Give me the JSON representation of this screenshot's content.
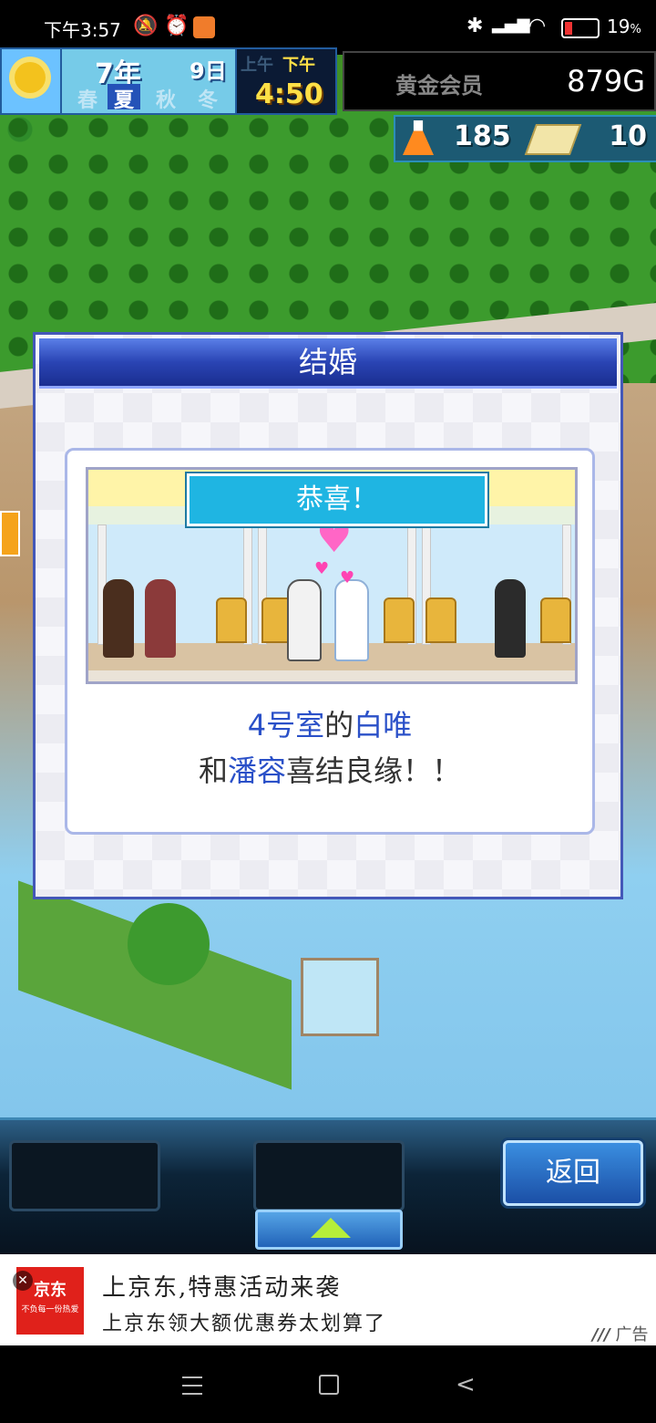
{
  "status_bar": {
    "time": "下午3:57",
    "battery_percent": "19",
    "battery_unit": "%"
  },
  "hud": {
    "year": "7年",
    "month_day": "9日",
    "seasons": [
      "春",
      "夏",
      "秋",
      "冬"
    ],
    "active_season": "夏",
    "am": "上午",
    "pm": "下午",
    "clock": "4:50",
    "rank": "黄金会员",
    "gold": "879G",
    "research_points": "185",
    "tickets": "10"
  },
  "dialog": {
    "title": "结婚",
    "banner": "恭喜！",
    "room": "4号室",
    "particle1": "的",
    "tenant": "白唯",
    "particle2": "和",
    "partner": "潘容",
    "message_end": "喜结良缘！！"
  },
  "bottom_bar": {
    "back_label": "返回"
  },
  "ad": {
    "close": "✕",
    "logo_text": "京东",
    "logo_sub": "不负每一份热爱",
    "title": "上京东,特惠活动来袭",
    "subtitle": "上京东领大额优惠券太划算了",
    "tag": "广告"
  },
  "colors": {
    "dialog_title_bar": "#2a44b4",
    "highlight_text": "#2a50c8",
    "banner": "#1fb5e2",
    "gold_text": "#ffe046"
  }
}
